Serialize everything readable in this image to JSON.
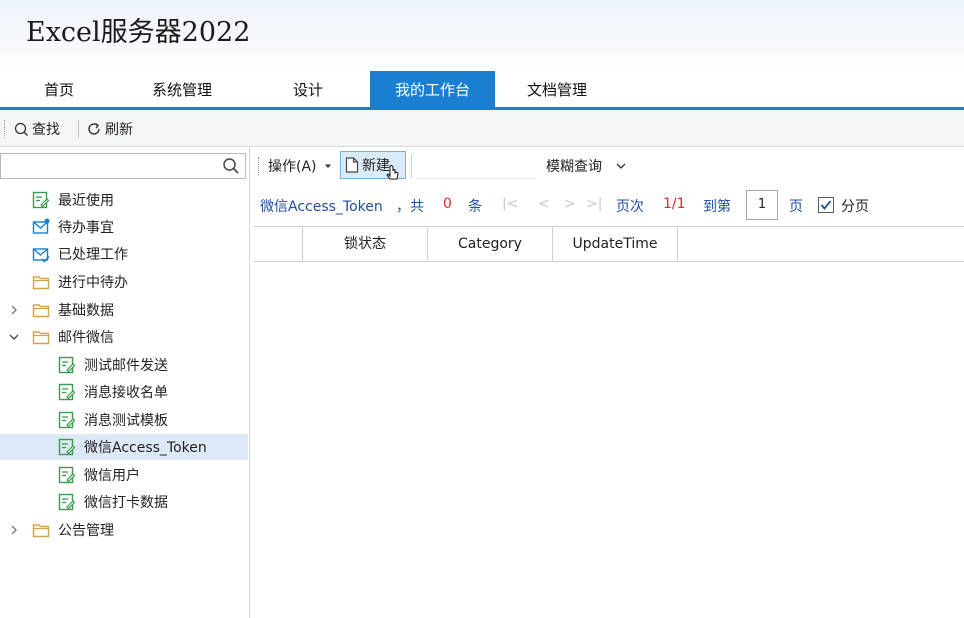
{
  "app": {
    "title": "Excel服务器2022"
  },
  "nav": {
    "tabs": [
      {
        "label": "首页"
      },
      {
        "label": "系统管理"
      },
      {
        "label": "设计"
      },
      {
        "label": "我的工作台"
      },
      {
        "label": "文档管理"
      }
    ],
    "active_index": 3
  },
  "toolbar": {
    "find_label": "查找",
    "refresh_label": "刷新"
  },
  "sidebar": {
    "search": {
      "value": "",
      "placeholder": ""
    },
    "items": [
      {
        "label": "最近使用",
        "icon": "form-edit-icon"
      },
      {
        "label": "待办事宜",
        "icon": "mail-notify-icon"
      },
      {
        "label": "已处理工作",
        "icon": "mail-check-icon"
      },
      {
        "label": "进行中待办",
        "icon": "folder-icon"
      },
      {
        "label": "基础数据",
        "icon": "folder-icon",
        "expandable": "collapsed"
      },
      {
        "label": "邮件微信",
        "icon": "folder-icon",
        "expandable": "expanded"
      },
      {
        "label": "测试邮件发送",
        "icon": "form-edit-icon"
      },
      {
        "label": "消息接收名单",
        "icon": "form-edit-icon"
      },
      {
        "label": "消息测试模板",
        "icon": "form-edit-icon"
      },
      {
        "label": "微信Access_Token",
        "icon": "form-edit-icon",
        "selected": true
      },
      {
        "label": "微信用户",
        "icon": "form-edit-icon"
      },
      {
        "label": "微信打卡数据",
        "icon": "form-edit-icon"
      },
      {
        "label": "公告管理",
        "icon": "folder-icon",
        "expandable": "collapsed"
      }
    ]
  },
  "actions": {
    "operation_label": "操作(A)",
    "new_label": "新建",
    "filter": {
      "value": "",
      "placeholder": ""
    },
    "fuzzy_label": "模糊查询"
  },
  "pager": {
    "table_name": "微信Access_Token",
    "total_prefix": "，共",
    "total_count": "0",
    "total_suffix": "条",
    "nav_first": "|<",
    "nav_prev": "<",
    "nav_next": ">",
    "nav_last": ">|",
    "page_label": "页次",
    "page_value": "1/1",
    "goto_label": "到第",
    "goto_value": "1",
    "goto_suffix": "页",
    "paging_label": "分页",
    "paging_checked": true
  },
  "grid": {
    "columns": [
      "",
      "锁状态",
      "Category",
      "UpdateTime"
    ]
  },
  "colors": {
    "accent": "#1b7fd1",
    "link_blue": "#1f4fa6",
    "count_red": "#e02a2a",
    "icon_green": "#3b9a4d",
    "icon_blue": "#1b7fd1",
    "folder_orange": "#d8a24a"
  }
}
